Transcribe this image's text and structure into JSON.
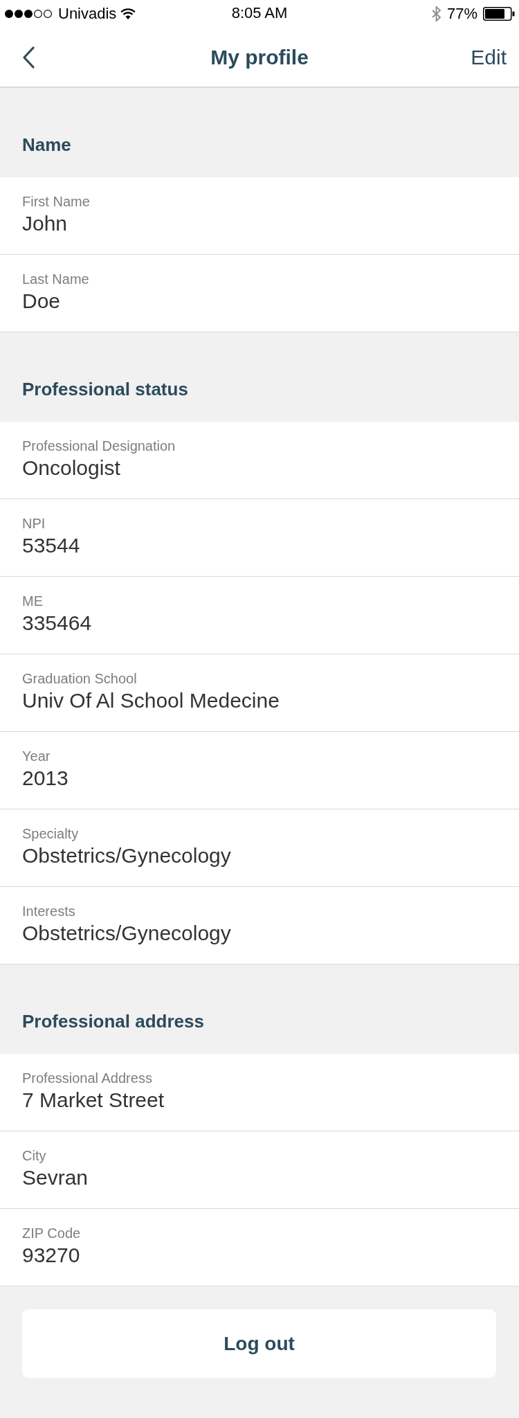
{
  "status_bar": {
    "carrier": "Univadis",
    "time": "8:05 AM",
    "battery": "77%"
  },
  "nav": {
    "title": "My profile",
    "action": "Edit"
  },
  "sections": [
    {
      "title": "Name",
      "fields": [
        {
          "label": "First Name",
          "value": "John"
        },
        {
          "label": "Last Name",
          "value": "Doe"
        }
      ]
    },
    {
      "title": "Professional status",
      "fields": [
        {
          "label": "Professional Designation",
          "value": "Oncologist"
        },
        {
          "label": "NPI",
          "value": "53544"
        },
        {
          "label": "ME",
          "value": "335464"
        },
        {
          "label": "Graduation School",
          "value": "Univ Of Al School Medecine"
        },
        {
          "label": "Year",
          "value": "2013"
        },
        {
          "label": "Specialty",
          "value": "Obstetrics/Gynecology"
        },
        {
          "label": "Interests",
          "value": "Obstetrics/Gynecology"
        }
      ]
    },
    {
      "title": "Professional address",
      "fields": [
        {
          "label": "Professional Address",
          "value": "7 Market Street"
        },
        {
          "label": "City",
          "value": "Sevran"
        },
        {
          "label": "ZIP Code",
          "value": "93270"
        }
      ]
    }
  ],
  "logout_button": "Log out"
}
